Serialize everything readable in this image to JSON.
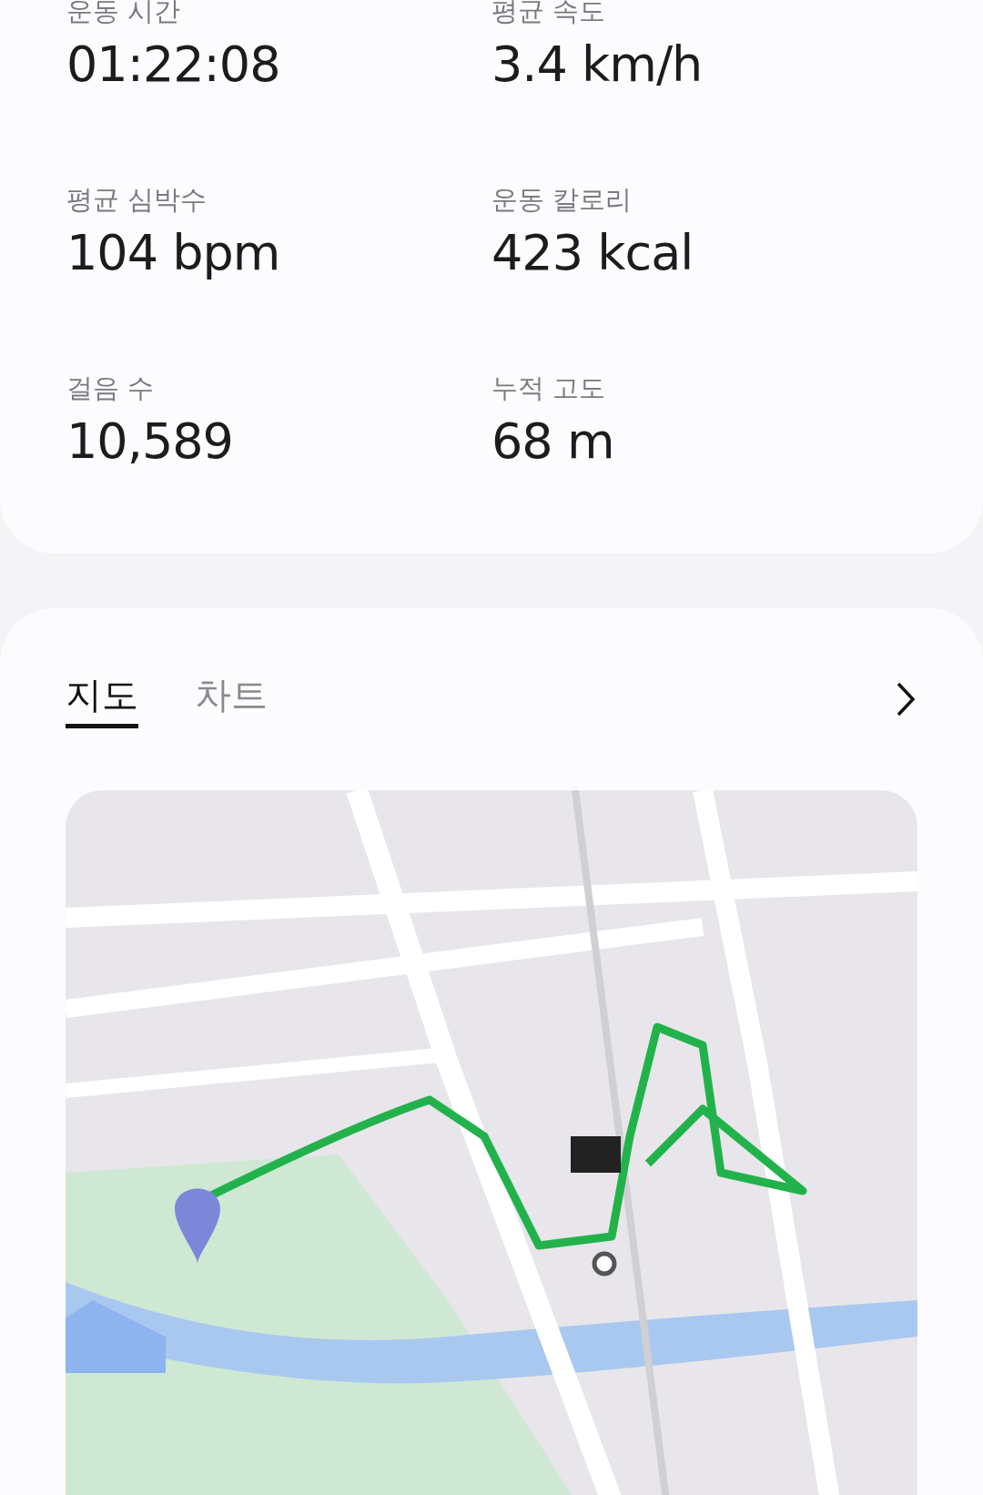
{
  "stats": [
    {
      "label": "운동 시간",
      "value": "01:22:08"
    },
    {
      "label": "평균 속도",
      "value": "3.4 km/h"
    },
    {
      "label": "평균 심박수",
      "value": "104 bpm"
    },
    {
      "label": "운동 칼로리",
      "value": "423 kcal"
    },
    {
      "label": "걸음 수",
      "value": "10,589"
    },
    {
      "label": "누적 고도",
      "value": "68 m"
    }
  ],
  "tabs": [
    {
      "label": "지도",
      "selected": true
    },
    {
      "label": "차트",
      "selected": false
    }
  ]
}
